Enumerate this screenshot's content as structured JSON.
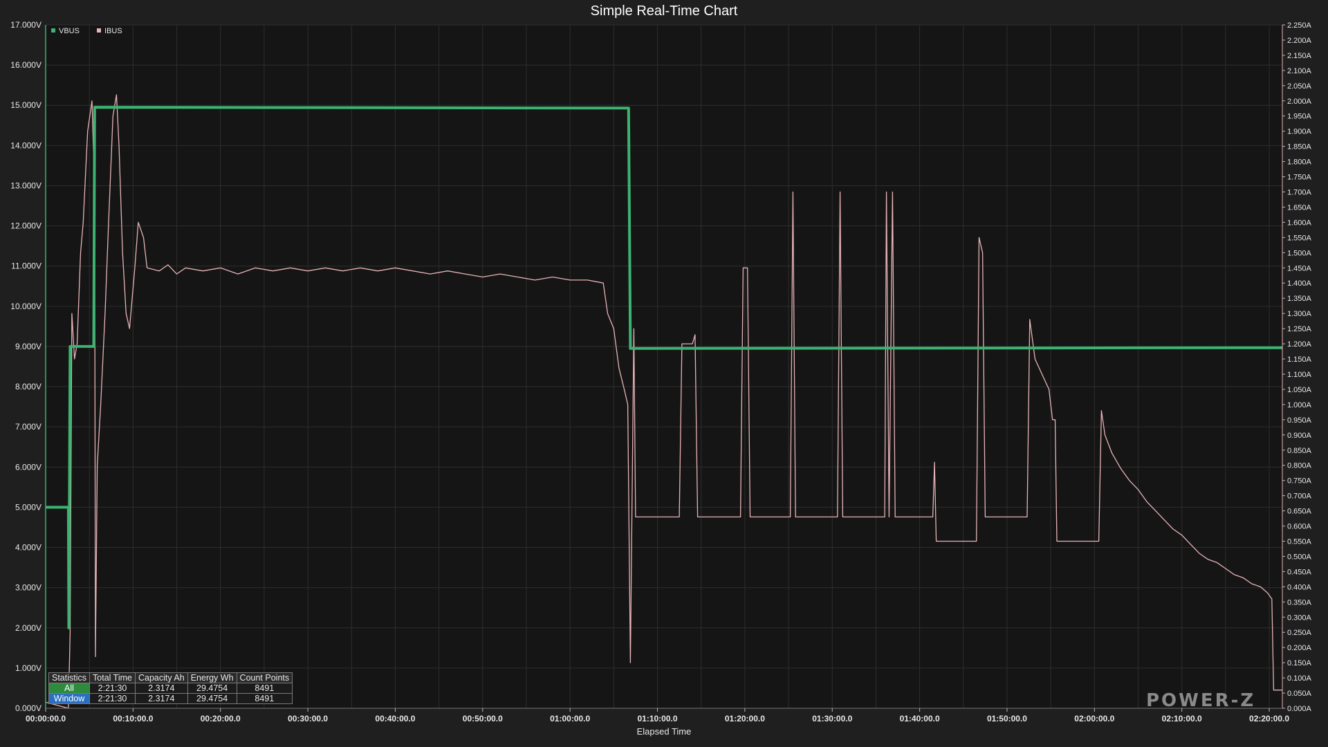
{
  "chart_data": {
    "type": "line",
    "title": "Simple Real-Time Chart",
    "xlabel": "Elapsed Time",
    "x_unit": "minutes",
    "xlim": [
      0,
      141.5
    ],
    "x_ticks": [
      "00:00:00.0",
      "00:10:00.0",
      "00:20:00.0",
      "00:30:00.0",
      "00:40:00.0",
      "00:50:00.0",
      "01:00:00.0",
      "01:10:00.0",
      "01:20:00.0",
      "01:30:00.0",
      "01:40:00.0",
      "01:50:00.0",
      "02:00:00.0",
      "02:10:00.0",
      "02:20:00.0"
    ],
    "y_left": {
      "unit": "V",
      "ylim": [
        0,
        17
      ],
      "ticks": [
        "0.000V",
        "1.000V",
        "2.000V",
        "3.000V",
        "4.000V",
        "5.000V",
        "6.000V",
        "7.000V",
        "8.000V",
        "9.000V",
        "10.000V",
        "11.000V",
        "12.000V",
        "13.000V",
        "14.000V",
        "15.000V",
        "16.000V",
        "17.000V"
      ]
    },
    "y_right": {
      "unit": "A",
      "ylim": [
        0,
        2.25
      ],
      "ticks": [
        "0.000A",
        "0.050A",
        "0.100A",
        "0.150A",
        "0.200A",
        "0.250A",
        "0.300A",
        "0.350A",
        "0.400A",
        "0.450A",
        "0.500A",
        "0.550A",
        "0.600A",
        "0.650A",
        "0.700A",
        "0.750A",
        "0.800A",
        "0.850A",
        "0.900A",
        "0.950A",
        "1.000A",
        "1.050A",
        "1.100A",
        "1.150A",
        "1.200A",
        "1.250A",
        "1.300A",
        "1.350A",
        "1.400A",
        "1.450A",
        "1.500A",
        "1.550A",
        "1.600A",
        "1.650A",
        "1.700A",
        "1.750A",
        "1.800A",
        "1.850A",
        "1.900A",
        "1.950A",
        "2.000A",
        "2.050A",
        "2.100A",
        "2.150A",
        "2.200A",
        "2.250A"
      ]
    },
    "grid": true,
    "legend_position": "top-left",
    "series": [
      {
        "name": "VBUS",
        "axis": "left",
        "color": "#3cb371",
        "points": [
          [
            0,
            5.0
          ],
          [
            2.6,
            5.0
          ],
          [
            2.65,
            2.0
          ],
          [
            2.8,
            9.0
          ],
          [
            5.5,
            9.0
          ],
          [
            5.6,
            14.95
          ],
          [
            66.7,
            14.93
          ],
          [
            66.9,
            8.95
          ],
          [
            141.5,
            8.97
          ]
        ]
      },
      {
        "name": "IBUS",
        "axis": "right",
        "color": "#e8b4b8",
        "points": [
          [
            0,
            0.02
          ],
          [
            2.6,
            0.0
          ],
          [
            2.8,
            0.25
          ],
          [
            3.0,
            1.3
          ],
          [
            3.3,
            1.15
          ],
          [
            3.6,
            1.2
          ],
          [
            4.0,
            1.5
          ],
          [
            4.3,
            1.6
          ],
          [
            4.8,
            1.9
          ],
          [
            5.3,
            2.0
          ],
          [
            5.6,
            1.7
          ],
          [
            5.7,
            0.17
          ],
          [
            5.9,
            0.8
          ],
          [
            6.3,
            1.0
          ],
          [
            6.8,
            1.3
          ],
          [
            7.2,
            1.6
          ],
          [
            7.7,
            1.95
          ],
          [
            8.1,
            2.02
          ],
          [
            8.4,
            1.85
          ],
          [
            8.8,
            1.5
          ],
          [
            9.2,
            1.3
          ],
          [
            9.6,
            1.25
          ],
          [
            10.2,
            1.45
          ],
          [
            10.6,
            1.6
          ],
          [
            11.2,
            1.55
          ],
          [
            11.6,
            1.45
          ],
          [
            13,
            1.44
          ],
          [
            14,
            1.46
          ],
          [
            15,
            1.43
          ],
          [
            16,
            1.45
          ],
          [
            18,
            1.44
          ],
          [
            20,
            1.45
          ],
          [
            22,
            1.43
          ],
          [
            24,
            1.45
          ],
          [
            26,
            1.44
          ],
          [
            28,
            1.45
          ],
          [
            30,
            1.44
          ],
          [
            32,
            1.45
          ],
          [
            34,
            1.44
          ],
          [
            36,
            1.45
          ],
          [
            38,
            1.44
          ],
          [
            40,
            1.45
          ],
          [
            42,
            1.44
          ],
          [
            44,
            1.43
          ],
          [
            46,
            1.44
          ],
          [
            48,
            1.43
          ],
          [
            50,
            1.42
          ],
          [
            52,
            1.43
          ],
          [
            54,
            1.42
          ],
          [
            56,
            1.41
          ],
          [
            58,
            1.42
          ],
          [
            60,
            1.41
          ],
          [
            62,
            1.41
          ],
          [
            63.8,
            1.4
          ],
          [
            64.3,
            1.3
          ],
          [
            65,
            1.25
          ],
          [
            65.6,
            1.12
          ],
          [
            66.2,
            1.05
          ],
          [
            66.6,
            1.0
          ],
          [
            66.9,
            0.15
          ],
          [
            67.1,
            0.7
          ],
          [
            67.3,
            1.25
          ],
          [
            67.5,
            0.63
          ],
          [
            72.5,
            0.63
          ],
          [
            72.8,
            1.2
          ],
          [
            74.0,
            1.2
          ],
          [
            74.3,
            1.23
          ],
          [
            74.6,
            0.63
          ],
          [
            79.5,
            0.63
          ],
          [
            79.8,
            1.45
          ],
          [
            80.3,
            1.45
          ],
          [
            80.6,
            0.63
          ],
          [
            85.2,
            0.63
          ],
          [
            85.5,
            1.7
          ],
          [
            85.8,
            0.63
          ],
          [
            90.6,
            0.63
          ],
          [
            90.9,
            1.7
          ],
          [
            91.2,
            0.63
          ],
          [
            96.0,
            0.63
          ],
          [
            96.2,
            1.7
          ],
          [
            96.5,
            0.63
          ],
          [
            96.9,
            1.7
          ],
          [
            97.2,
            0.63
          ],
          [
            101.5,
            0.63
          ],
          [
            101.7,
            0.81
          ],
          [
            101.9,
            0.55
          ],
          [
            106.5,
            0.55
          ],
          [
            106.8,
            1.55
          ],
          [
            107.2,
            1.5
          ],
          [
            107.5,
            0.63
          ],
          [
            112.3,
            0.63
          ],
          [
            112.6,
            1.28
          ],
          [
            113.2,
            1.15
          ],
          [
            114.0,
            1.1
          ],
          [
            114.8,
            1.05
          ],
          [
            115.2,
            0.95
          ],
          [
            115.5,
            0.95
          ],
          [
            115.7,
            0.55
          ],
          [
            120.5,
            0.55
          ],
          [
            120.8,
            0.98
          ],
          [
            121.2,
            0.9
          ],
          [
            122,
            0.84
          ],
          [
            123,
            0.79
          ],
          [
            124,
            0.75
          ],
          [
            125,
            0.72
          ],
          [
            126,
            0.68
          ],
          [
            127,
            0.65
          ],
          [
            128,
            0.62
          ],
          [
            129,
            0.59
          ],
          [
            130,
            0.57
          ],
          [
            131,
            0.54
          ],
          [
            132,
            0.51
          ],
          [
            133,
            0.49
          ],
          [
            134,
            0.48
          ],
          [
            135,
            0.46
          ],
          [
            136,
            0.44
          ],
          [
            137,
            0.43
          ],
          [
            138,
            0.41
          ],
          [
            139,
            0.4
          ],
          [
            139.8,
            0.38
          ],
          [
            140.3,
            0.36
          ],
          [
            140.5,
            0.06
          ],
          [
            141.5,
            0.06
          ]
        ]
      }
    ]
  },
  "legend": {
    "items": [
      {
        "label": "VBUS",
        "color": "#3cb371"
      },
      {
        "label": "IBUS",
        "color": "#e8b4b8"
      }
    ]
  },
  "stats": {
    "headers": [
      "Statistics",
      "Total Time",
      "Capacity Ah",
      "Energy Wh",
      "Count Points"
    ],
    "rows": [
      {
        "label": "All",
        "total_time": "2:21:30",
        "capacity": "2.3174",
        "energy": "29.4754",
        "count": "8491"
      },
      {
        "label": "Window",
        "total_time": "2:21:30",
        "capacity": "2.3174",
        "energy": "29.4754",
        "count": "8491"
      }
    ]
  },
  "watermark": {
    "text": "POWER-Z"
  }
}
